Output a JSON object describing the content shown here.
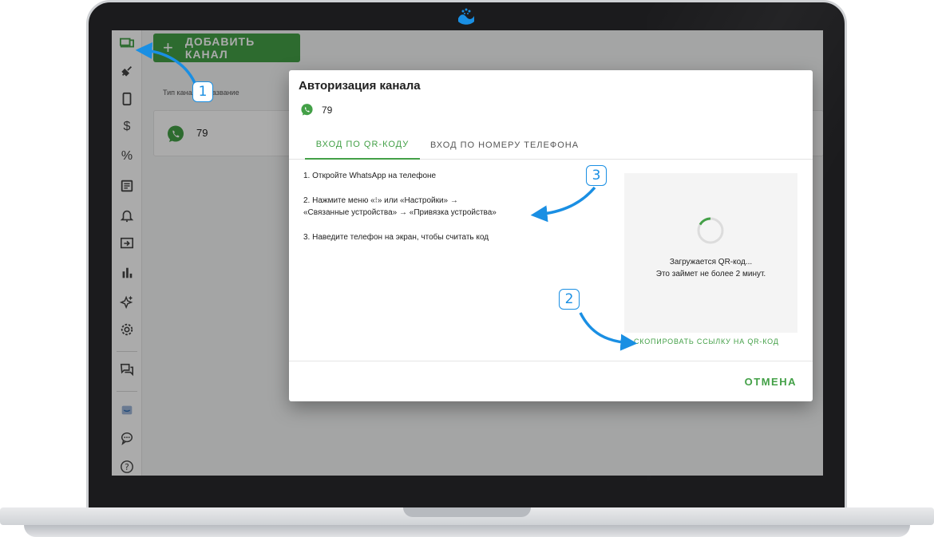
{
  "header": {
    "add_channel_label": "ДОБАВИТЬ КАНАЛ"
  },
  "table": {
    "column_header": "Тип канала и название",
    "rows": [
      {
        "name": "79"
      }
    ]
  },
  "dialog": {
    "title": "Авторизация канала",
    "channel_name": "79",
    "tabs": [
      {
        "label": "ВХОД ПО QR-КОДУ",
        "active": true
      },
      {
        "label": "ВХОД ПО НОМЕРУ ТЕЛЕФОНА",
        "active": false
      }
    ],
    "steps": [
      "1. Откройте WhatsApp на телефоне",
      "2. Нажмите меню «⁝» или «Настройки» →",
      "«Связанные устройства» → «Привязка устройства»",
      "3. Наведите телефон на экран, чтобы считать код"
    ],
    "qr_loading": "Загружается QR-код...",
    "qr_wait": "Это займет не более 2 минут.",
    "copy_link_label": "СКОПИРОВАТЬ ССЫЛКУ НА QR-КОД",
    "cancel_label": "ОТМЕНА"
  },
  "annotations": {
    "badge_1": "1",
    "badge_2": "2",
    "badge_3": "3"
  },
  "sidebar": {
    "icons": [
      "channels-icon",
      "integrations-icon",
      "mobile-icon",
      "dollar-icon",
      "percent-icon",
      "notes-icon",
      "bell-icon",
      "forward-icon",
      "stats-icon",
      "sparkle-icon",
      "settings-icon",
      "chat-icon",
      "logo-icon",
      "support-chat-icon",
      "help-icon"
    ]
  },
  "colors": {
    "accent": "#43a047",
    "annotation": "#1a8fe3"
  }
}
